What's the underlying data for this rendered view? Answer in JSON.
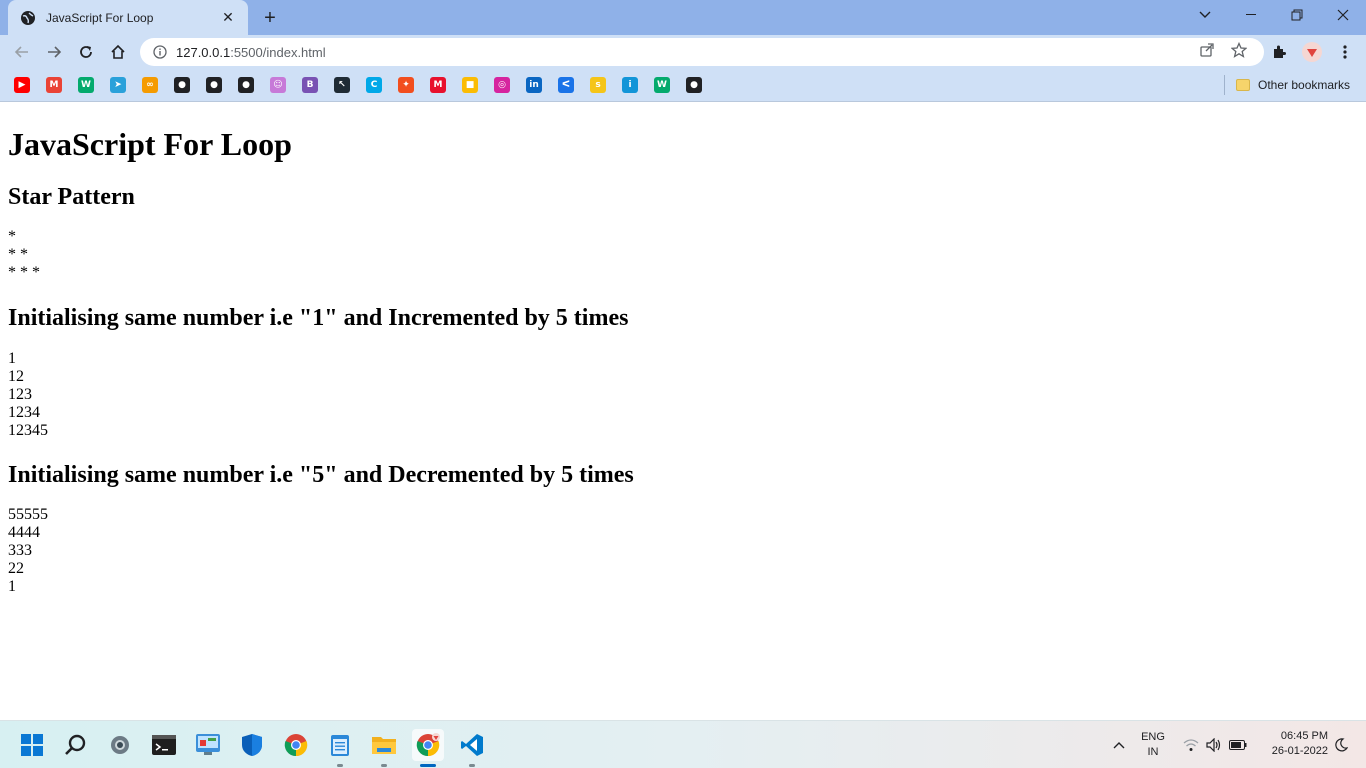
{
  "browser": {
    "tab_title": "JavaScript For Loop",
    "url_host": "127.0.0.1",
    "url_path": ":5500/index.html",
    "other_bookmarks": "Other bookmarks",
    "bookmarks": [
      {
        "name": "youtube",
        "color": "#ff0000",
        "glyph": "▶"
      },
      {
        "name": "gmail",
        "color": "#ea4335",
        "glyph": "M"
      },
      {
        "name": "w3schools",
        "color": "#04aa6d",
        "glyph": "W"
      },
      {
        "name": "telegram",
        "color": "#2aa1da",
        "glyph": "➤"
      },
      {
        "name": "coursera",
        "color": "#f59b00",
        "glyph": "∞"
      },
      {
        "name": "globe",
        "color": "#202124",
        "glyph": "●"
      },
      {
        "name": "github",
        "color": "#202124",
        "glyph": "●"
      },
      {
        "name": "github",
        "color": "#202124",
        "glyph": "●"
      },
      {
        "name": "avatar",
        "color": "#c77ad8",
        "glyph": "☺"
      },
      {
        "name": "bootstrap",
        "color": "#7952b3",
        "glyph": "B"
      },
      {
        "name": "cursor",
        "color": "#1f2b35",
        "glyph": "↖"
      },
      {
        "name": "canva",
        "color": "#00a8e8",
        "glyph": "C"
      },
      {
        "name": "figma",
        "color": "#f24e1e",
        "glyph": "✦"
      },
      {
        "name": "mail",
        "color": "#e8112d",
        "glyph": "M"
      },
      {
        "name": "keep",
        "color": "#fbbc04",
        "glyph": "■"
      },
      {
        "name": "instagram",
        "color": "#d6249f",
        "glyph": "◎"
      },
      {
        "name": "linkedin",
        "color": "#0a66c2",
        "glyph": "in"
      },
      {
        "name": "kite",
        "color": "#1a73e8",
        "glyph": "ᐸ"
      },
      {
        "name": "shine",
        "color": "#f5c518",
        "glyph": "s"
      },
      {
        "name": "internshala",
        "color": "#1295d8",
        "glyph": "i"
      },
      {
        "name": "w3schools",
        "color": "#04aa6d",
        "glyph": "W"
      },
      {
        "name": "github",
        "color": "#202124",
        "glyph": "●"
      }
    ]
  },
  "page": {
    "title": "JavaScript For Loop",
    "star_heading": "Star Pattern",
    "star_lines": [
      "*",
      "* *",
      "* * *"
    ],
    "inc_heading": "Initialising same number i.e \"1\" and Incremented by 5 times",
    "inc_lines": [
      "1",
      "12",
      "123",
      "1234",
      "12345"
    ],
    "dec_heading": "Initialising same number i.e \"5\" and Decremented by 5 times",
    "dec_lines": [
      "55555",
      "4444",
      "333",
      "22",
      "1"
    ]
  },
  "taskbar": {
    "apps": [
      "windows-start",
      "search",
      "settings",
      "terminal",
      "control-panel",
      "windows-security",
      "chrome",
      "notepad",
      "file-explorer",
      "chrome-active",
      "vscode"
    ],
    "lang_line1": "ENG",
    "lang_line2": "IN",
    "time": "06:45 PM",
    "date": "26-01-2022"
  }
}
